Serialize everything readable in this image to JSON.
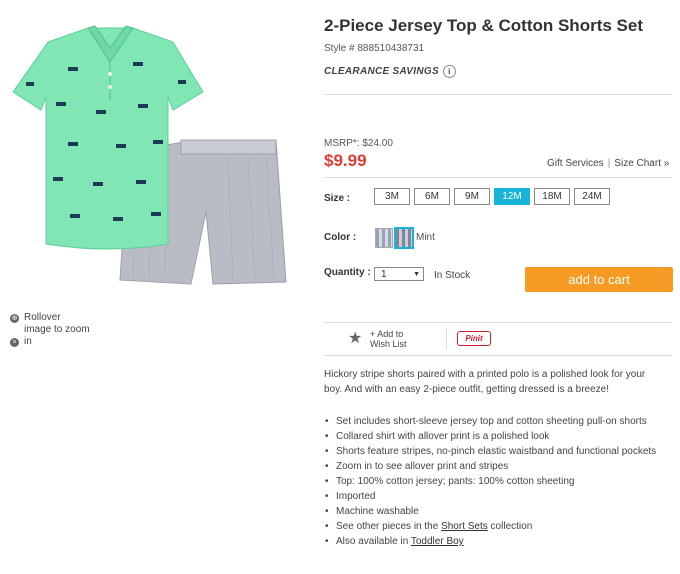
{
  "product": {
    "title": "2-Piece Jersey Top & Cotton Shorts Set",
    "style": "Style # 888510438731",
    "clearance": "CLEARANCE SAVINGS",
    "clearance_info": "i",
    "msrp": "MSRP*: $24.00",
    "price": "$9.99",
    "price_color": "#e03b35"
  },
  "zoom_hint": {
    "line1": "Rollover",
    "line2": "image to zoom",
    "line3": "in"
  },
  "links": {
    "gift_services": "Gift Services",
    "size_chart": "Size Chart »"
  },
  "size": {
    "label": "Size :",
    "options": [
      "3M",
      "6M",
      "9M",
      "12M",
      "18M",
      "24M"
    ],
    "selected": "12M",
    "selected_color": "#18b4d8"
  },
  "color": {
    "label": "Color :",
    "selected_name": "Mint"
  },
  "quantity": {
    "label": "Quantity :",
    "value": "1",
    "stock": "In Stock"
  },
  "cart": {
    "label": "add to cart",
    "color": "#f59a22"
  },
  "social": {
    "wishlist_line1": "+ Add to",
    "wishlist_line2": "Wish List",
    "pinit": "Pinit"
  },
  "description": "Hickory stripe shorts paired with a printed polo is a polished look for your boy. And with an easy 2-piece outfit, getting dressed is a breeze!",
  "bullets": [
    "Set includes short-sleeve jersey top and cotton sheeting pull-on shorts",
    "Collared shirt with allover print is a polished look",
    "Shorts feature stripes, no-pinch elastic waistband and functional pockets",
    "Zoom in to see allover print and stripes",
    "Top: 100% cotton jersey; pants: 100% cotton sheeting",
    "Imported",
    "Machine washable"
  ],
  "bullet_link1": {
    "prefix": "See other pieces in the ",
    "link": "Short Sets",
    "suffix": " collection"
  },
  "bullet_link2": {
    "prefix": "Also available in ",
    "link": "Toddler Boy"
  }
}
